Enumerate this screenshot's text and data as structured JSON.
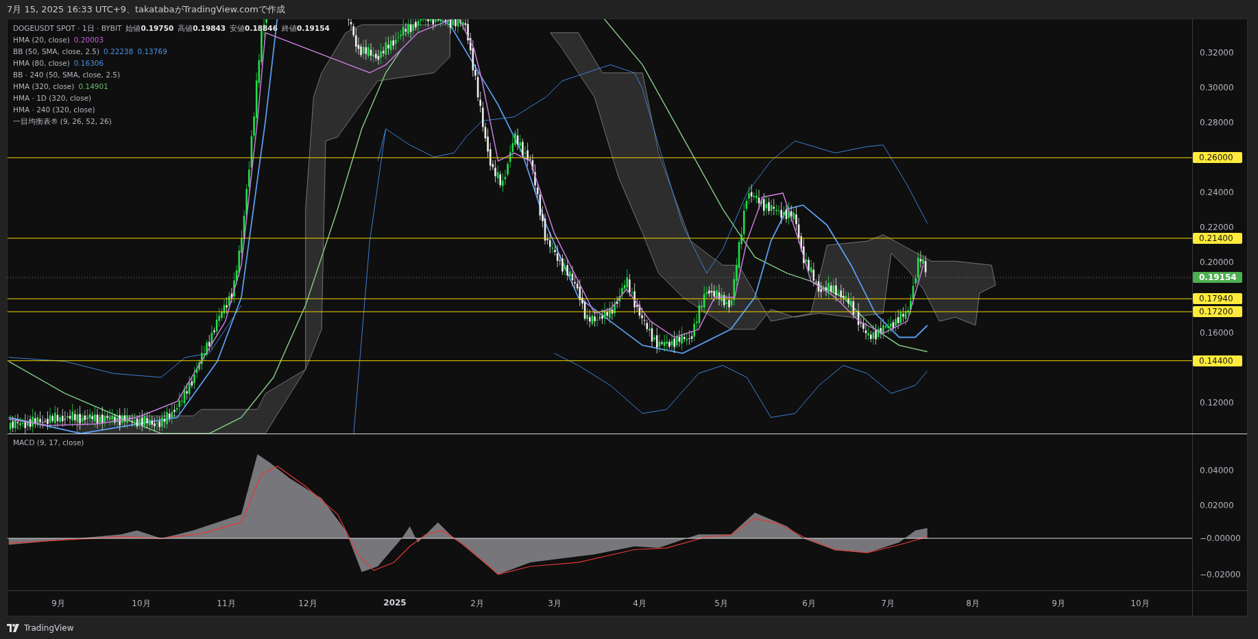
{
  "header": {
    "text": "7月 15, 2025 16:33 UTC+9、takatabaがTradingView.comで作成"
  },
  "legend": {
    "symbol": "DOGEUSDT SPOT · 1日 · BYBIT",
    "ohlc": [
      {
        "label": "始値",
        "value": "0.19750"
      },
      {
        "label": "高値",
        "value": "0.19843"
      },
      {
        "label": "安値",
        "value": "0.18846"
      },
      {
        "label": "終値",
        "value": "0.19154"
      }
    ],
    "indicators": [
      {
        "label": "HMA (20, close)",
        "values": [
          {
            "text": "0.20003",
            "color": "#c45fd4"
          }
        ]
      },
      {
        "label": "BB (50, SMA, close, 2.5)",
        "values": [
          {
            "text": "0.22238",
            "color": "#4a8fe0"
          },
          {
            "text": "0.13769",
            "color": "#4a8fe0"
          }
        ]
      },
      {
        "label": "HMA (80, close)",
        "values": [
          {
            "text": "0.16306",
            "color": "#4a8fe0"
          }
        ]
      },
      {
        "label": "BB · 240 (50, SMA, close, 2.5)"
      },
      {
        "label": "HMA (320, close)",
        "values": [
          {
            "text": "0.14901",
            "color": "#66bb6a"
          }
        ]
      },
      {
        "label": "HMA · 1D (320, close)"
      },
      {
        "label": "HMA · 240 (320, close)"
      },
      {
        "label": "一目均衡表® (9, 26, 52, 26)"
      }
    ]
  },
  "price_axis": {
    "ticks": [
      "0.32000",
      "0.30000",
      "0.28000",
      "0.24000",
      "0.22000",
      "0.20000",
      "0.16000",
      "0.12000"
    ],
    "levels": [
      {
        "kind": "level",
        "text": "0.26000"
      },
      {
        "kind": "level",
        "text": "0.21400"
      },
      {
        "kind": "last",
        "text": "0.19154"
      },
      {
        "kind": "level",
        "text": "0.17940"
      },
      {
        "kind": "level",
        "text": "0.17200"
      },
      {
        "kind": "level",
        "text": "0.14400"
      }
    ]
  },
  "macd": {
    "label": "MACD (9, 17, close)",
    "ticks": [
      "0.04000",
      "0.02000",
      "−0.00000",
      "−0.02000"
    ]
  },
  "time_axis": [
    {
      "kind": "month",
      "text": "9月"
    },
    {
      "kind": "month",
      "text": "10月"
    },
    {
      "kind": "month",
      "text": "11月"
    },
    {
      "kind": "month",
      "text": "12月"
    },
    {
      "kind": "year",
      "text": "2025"
    },
    {
      "kind": "month",
      "text": "2月"
    },
    {
      "kind": "month",
      "text": "3月"
    },
    {
      "kind": "month",
      "text": "4月"
    },
    {
      "kind": "month",
      "text": "5月"
    },
    {
      "kind": "month",
      "text": "6月"
    },
    {
      "kind": "month",
      "text": "7月"
    },
    {
      "kind": "month",
      "text": "8月"
    },
    {
      "kind": "month",
      "text": "9月"
    },
    {
      "kind": "month",
      "text": "10月"
    }
  ],
  "footer": {
    "brand": "TradingView"
  }
}
